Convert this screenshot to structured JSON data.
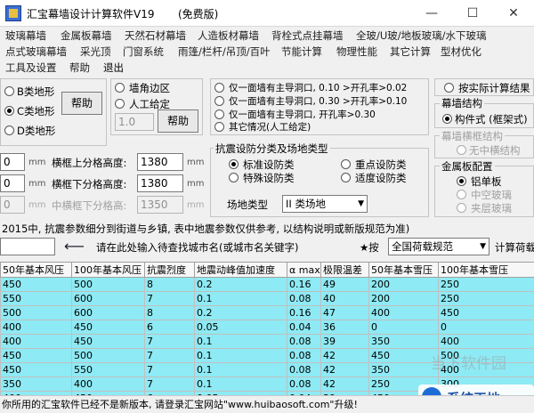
{
  "window": {
    "title": "汇宝幕墙设计计算软件V19",
    "edition": "(免费版)",
    "min_glyph": "—",
    "max_glyph": "☐",
    "close_glyph": "✕"
  },
  "menu": {
    "row1": [
      "玻璃幕墙",
      "金属板幕墙",
      "天然石材幕墙",
      "人造板材幕墙",
      "背栓式点挂幕墙",
      "全玻/U玻/地板玻璃/水下玻璃"
    ],
    "row2": [
      "点式玻璃幕墙",
      "采光顶",
      "门窗系统",
      "雨篷/栏杆/吊顶/百叶",
      "节能计算",
      "物理性能",
      "其它计算",
      "型材优化"
    ],
    "row3": [
      "工具及设置",
      "帮助",
      "退出"
    ]
  },
  "shape_group": {
    "options": [
      "B类地形",
      "C类地形",
      "D类地形"
    ],
    "selected": 1,
    "help": "帮助"
  },
  "wall_group": {
    "opt1": "墙角边区",
    "opt2": "人工给定",
    "value": "1.0",
    "help": "帮助"
  },
  "hole_group": {
    "opt1": "仅一面墙有主导洞口, 0.10 >开孔率>0.02",
    "opt2": "仅一面墙有主导洞口, 0.30 >开孔率>0.10",
    "opt3": "仅一面墙有主导洞口, 开孔率>0.30",
    "opt4": "其它情况(人工给定)"
  },
  "calc_option": {
    "label": "按实际计算结果"
  },
  "structure": {
    "title": "幕墙结构",
    "opt1": "构件式 (框架式)"
  },
  "frame_struct": {
    "title": "幕墙横框结构",
    "opt1": "无中横结构"
  },
  "metal": {
    "title": "金属板配置",
    "opt1": "铝单板",
    "opt2": "中空玻璃",
    "opt3": "夹层玻璃"
  },
  "grid_labels": {
    "upper": "横框上分格高度:",
    "upper_val": "1380",
    "lower": "横框下分格高度:",
    "lower_val": "1380",
    "middle": "中横框下分格高:",
    "middle_val": "1350",
    "unit": "mm",
    "left1": "0",
    "left2": "0",
    "left3": "0"
  },
  "seismic": {
    "title": "抗震设防分类及场地类型",
    "opt1": "标准设防类",
    "opt2": "重点设防类",
    "opt3": "特殊设防类",
    "opt4": "适度设防类",
    "site_label": "场地类型",
    "site_value": "II 类场地"
  },
  "notice": "2015中, 抗震参数细分到街道与乡镇, 表中地震参数仅供参考, 以结构说明或新版规范为准)",
  "city": {
    "hint": "请在此处输入待查找城市名(或城市名关键字)",
    "star": "★按",
    "code": "全国荷载规范",
    "calc": "计算荷载",
    "arrow": "⟵"
  },
  "table": {
    "headers": [
      "50年基本风压",
      "100年基本风压",
      "抗震烈度",
      "地震动峰值加速度",
      "α max",
      "极限温差",
      "50年基本雪压",
      "100年基本雪压"
    ],
    "rows": [
      [
        "450",
        "500",
        "8",
        "0.2",
        "0.16",
        "49",
        "200",
        "250"
      ],
      [
        "550",
        "600",
        "7",
        "0.1",
        "0.08",
        "40",
        "200",
        "250"
      ],
      [
        "500",
        "600",
        "8",
        "0.2",
        "0.16",
        "47",
        "400",
        "450"
      ],
      [
        "400",
        "450",
        "6",
        "0.05",
        "0.04",
        "36",
        "0",
        "0"
      ],
      [
        "400",
        "450",
        "7",
        "0.1",
        "0.08",
        "39",
        "350",
        "400"
      ],
      [
        "450",
        "500",
        "7",
        "0.1",
        "0.08",
        "42",
        "450",
        "500"
      ],
      [
        "450",
        "550",
        "7",
        "0.1",
        "0.08",
        "42",
        "350",
        "400"
      ],
      [
        "350",
        "400",
        "7",
        "0.1",
        "0.08",
        "42",
        "250",
        "300"
      ],
      [
        "400",
        "450",
        "6",
        "0.05",
        "0.04",
        "39",
        "450",
        "500"
      ]
    ]
  },
  "status": "你所用的汇宝软件已经不是新版本, 请登录汇宝网站\"www.huibaosoft.com\"升级!",
  "watermarks": {
    "w1": "当下软件园",
    "w2": "系统天地"
  }
}
